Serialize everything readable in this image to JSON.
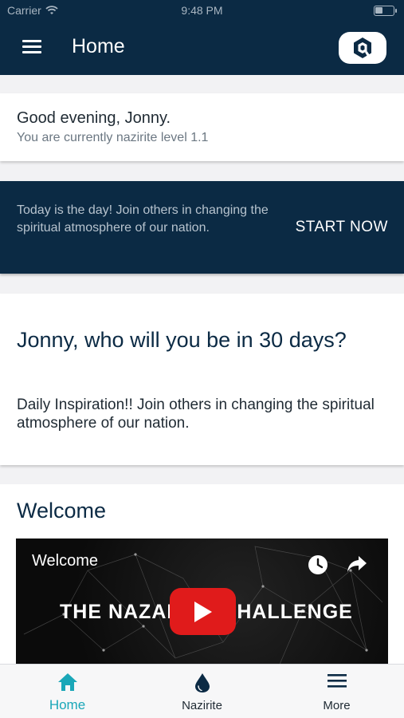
{
  "status_bar": {
    "carrier": "Carrier",
    "time": "9:48 PM"
  },
  "header": {
    "title": "Home",
    "logo_icon": "app-logo-icon",
    "menu_icon": "hamburger-icon"
  },
  "greeting": {
    "line1": "Good evening, Jonny.",
    "line2": "You are currently nazirite level 1.1"
  },
  "banner": {
    "text": "Today is the day! Join others in changing the spiritual atmosphere of our nation.",
    "action": "START NOW"
  },
  "inspiration": {
    "heading": "Jonny, who will you be in 30 days?",
    "body": "Daily Inspiration!! Join others in changing the spiritual atmosphere of our nation."
  },
  "welcome": {
    "heading": "Welcome",
    "video": {
      "title": "Welcome",
      "headline": "THE NAZARITE CHALLENGE"
    }
  },
  "tabs": [
    {
      "label": "Home",
      "icon": "home-icon",
      "active": true
    },
    {
      "label": "Nazirite",
      "icon": "drop-icon",
      "active": false
    },
    {
      "label": "More",
      "icon": "menu-icon",
      "active": false
    }
  ],
  "colors": {
    "primary": "#0b2a44",
    "accent": "#1aa7b8",
    "video_play": "#e01b1b"
  }
}
